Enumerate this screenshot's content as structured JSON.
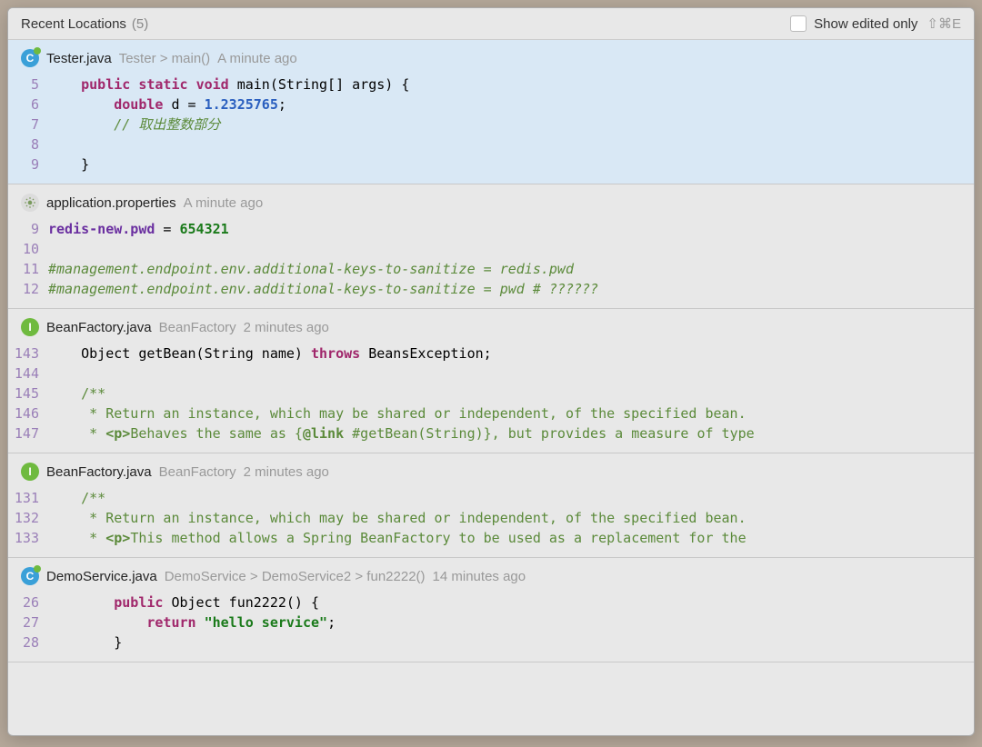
{
  "header": {
    "title": "Recent Locations",
    "count": "(5)",
    "show_edited_label": "Show edited only",
    "shortcut": "⇧⌘E"
  },
  "locations": [
    {
      "selected": true,
      "icon_type": "class",
      "icon_letter": "C",
      "file_name": "Tester.java",
      "breadcrumb": "Tester > main()",
      "timestamp": "A minute ago",
      "lines": [
        {
          "n": "5",
          "tokens": [
            [
              "    ",
              ""
            ],
            [
              "public",
              "kw"
            ],
            [
              " ",
              ""
            ],
            [
              "static",
              "kw"
            ],
            [
              " ",
              ""
            ],
            [
              "void",
              "kw"
            ],
            [
              " main(String[] args) {",
              ""
            ]
          ]
        },
        {
          "n": "6",
          "tokens": [
            [
              "        ",
              ""
            ],
            [
              "double",
              "kw"
            ],
            [
              " d = ",
              ""
            ],
            [
              "1.2325765",
              "num"
            ],
            [
              ";",
              ""
            ]
          ]
        },
        {
          "n": "7",
          "tokens": [
            [
              "        ",
              ""
            ],
            [
              "// 取出整数部分",
              "comment"
            ]
          ]
        },
        {
          "n": "8",
          "tokens": [
            [
              "",
              ""
            ]
          ]
        },
        {
          "n": "9",
          "tokens": [
            [
              "    }",
              ""
            ]
          ]
        }
      ]
    },
    {
      "selected": false,
      "icon_type": "props",
      "icon_letter": "",
      "file_name": "application.properties",
      "breadcrumb": "",
      "timestamp": "A minute ago",
      "lines": [
        {
          "n": "9",
          "tokens": [
            [
              "redis-new.pwd",
              "propkey"
            ],
            [
              " = ",
              ""
            ],
            [
              "654321",
              "propval"
            ]
          ]
        },
        {
          "n": "10",
          "tokens": [
            [
              "",
              ""
            ]
          ]
        },
        {
          "n": "11",
          "tokens": [
            [
              "#management.endpoint.env.additional-keys-to-sanitize = redis.pwd",
              "comment"
            ]
          ]
        },
        {
          "n": "12",
          "tokens": [
            [
              "#management.endpoint.env.additional-keys-to-sanitize = pwd # ??????",
              "comment"
            ]
          ]
        }
      ]
    },
    {
      "selected": false,
      "icon_type": "interface",
      "icon_letter": "I",
      "file_name": "BeanFactory.java",
      "breadcrumb": "BeanFactory",
      "timestamp": "2 minutes ago",
      "lines": [
        {
          "n": "143",
          "tokens": [
            [
              "    Object getBean(String name) ",
              ""
            ],
            [
              "throws",
              "kw"
            ],
            [
              " BeansException;",
              ""
            ]
          ]
        },
        {
          "n": "144",
          "tokens": [
            [
              "",
              ""
            ]
          ]
        },
        {
          "n": "145",
          "tokens": [
            [
              "    ",
              ""
            ],
            [
              "/**",
              "comment-doc"
            ]
          ]
        },
        {
          "n": "146",
          "tokens": [
            [
              "     ",
              ""
            ],
            [
              "* Return an instance, which may be shared or independent, of the specified bean.",
              "comment-doc"
            ]
          ]
        },
        {
          "n": "147",
          "tokens": [
            [
              "     ",
              ""
            ],
            [
              "* ",
              "comment-doc"
            ],
            [
              "<p>",
              "tag comment-doc"
            ],
            [
              "Behaves the same as {",
              "comment-doc"
            ],
            [
              "@link",
              "link"
            ],
            [
              " ",
              "comment-doc"
            ],
            [
              "#getBean(String)",
              "comment-doc"
            ],
            [
              "}, but provides a measure of type",
              "comment-doc"
            ]
          ]
        }
      ]
    },
    {
      "selected": false,
      "icon_type": "interface",
      "icon_letter": "I",
      "file_name": "BeanFactory.java",
      "breadcrumb": "BeanFactory",
      "timestamp": "2 minutes ago",
      "lines": [
        {
          "n": "131",
          "tokens": [
            [
              "    ",
              ""
            ],
            [
              "/**",
              "comment-doc"
            ]
          ]
        },
        {
          "n": "132",
          "tokens": [
            [
              "     ",
              ""
            ],
            [
              "* Return an instance, which may be shared or independent, of the specified bean.",
              "comment-doc"
            ]
          ]
        },
        {
          "n": "133",
          "tokens": [
            [
              "     ",
              ""
            ],
            [
              "* ",
              "comment-doc"
            ],
            [
              "<p>",
              "tag comment-doc"
            ],
            [
              "This method allows a Spring BeanFactory to be used as a replacement for the",
              "comment-doc"
            ]
          ]
        }
      ]
    },
    {
      "selected": false,
      "icon_type": "class",
      "icon_letter": "C",
      "file_name": "DemoService.java",
      "breadcrumb": "DemoService > DemoService2 > fun2222()",
      "timestamp": "14 minutes ago",
      "lines": [
        {
          "n": "26",
          "tokens": [
            [
              "        ",
              ""
            ],
            [
              "public",
              "kw"
            ],
            [
              " Object fun2222() {",
              ""
            ]
          ]
        },
        {
          "n": "27",
          "tokens": [
            [
              "            ",
              ""
            ],
            [
              "return",
              "kw"
            ],
            [
              " ",
              ""
            ],
            [
              "\"hello service\"",
              "str"
            ],
            [
              ";",
              ""
            ]
          ]
        },
        {
          "n": "28",
          "tokens": [
            [
              "        }",
              ""
            ]
          ]
        }
      ]
    }
  ]
}
